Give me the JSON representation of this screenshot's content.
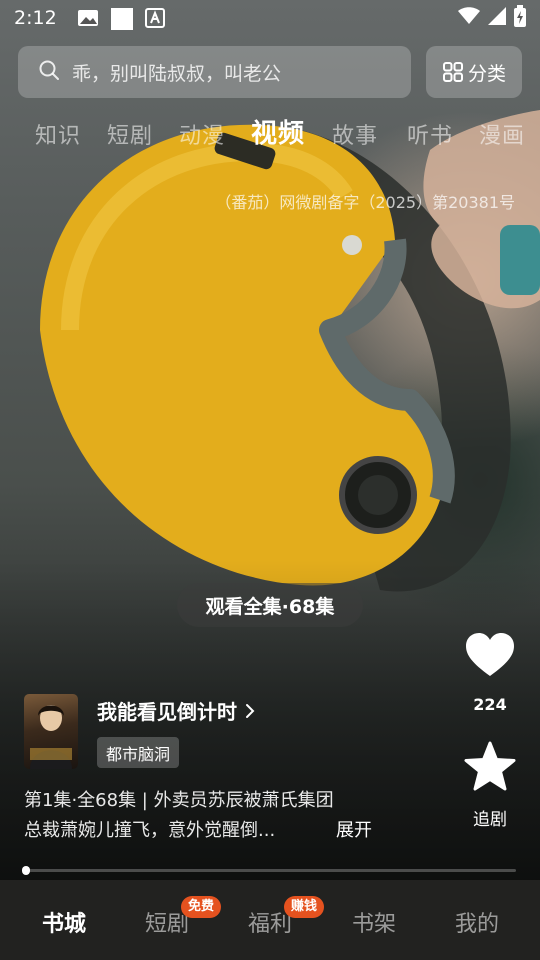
{
  "status_bar": {
    "time": "2:12"
  },
  "search": {
    "placeholder": "乖，别叫陆叔叔，叫老公"
  },
  "category_button": {
    "label": "分类"
  },
  "tabs": [
    {
      "label": "知识"
    },
    {
      "label": "短剧"
    },
    {
      "label": "动漫"
    },
    {
      "label": "视频",
      "active": true
    },
    {
      "label": "故事"
    },
    {
      "label": "听书"
    },
    {
      "label": "漫画"
    }
  ],
  "license": "（番茄）网微剧备字（2025）第20381号",
  "watch_all": {
    "label": "观看全集·68集"
  },
  "actions": {
    "like_count": "224",
    "follow_label": "追剧"
  },
  "drama": {
    "title": "我能看见倒计时",
    "tag": "都市脑洞",
    "desc_line1": "第1集·全68集 | 外卖员苏辰被萧氏集团",
    "desc_line2": "总裁萧婉儿撞飞，意外觉醒倒...",
    "expand_label": "展开"
  },
  "progress": {
    "fraction": 0.01
  },
  "bottom_nav": [
    {
      "label": "书城",
      "active": true
    },
    {
      "label": "短剧",
      "badge": "免费"
    },
    {
      "label": "福利",
      "badge": "赚钱"
    },
    {
      "label": "书架"
    },
    {
      "label": "我的"
    }
  ],
  "colors": {
    "badge": "#e5521f",
    "helmet": "#e8b21f",
    "nav_bg": "#222220"
  }
}
